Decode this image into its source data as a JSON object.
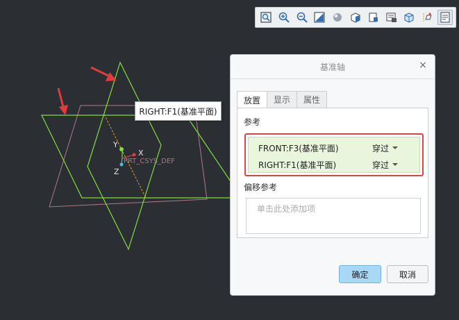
{
  "toolbar": {
    "buttons": [
      {
        "icon": "refit-icon"
      },
      {
        "icon": "zoom-in-icon"
      },
      {
        "icon": "zoom-out-icon"
      },
      {
        "icon": "repaint-icon"
      },
      {
        "icon": "shading-icon"
      },
      {
        "icon": "view-style-icon"
      },
      {
        "icon": "saved-orientations-icon"
      },
      {
        "icon": "view-manager-icon"
      },
      {
        "icon": "perspective-view-icon"
      },
      {
        "icon": "datum-display-icon"
      },
      {
        "icon": "annotation-display-icon"
      }
    ]
  },
  "viewport": {
    "csys_label": "PRT_CSYS_DEF",
    "axis_labels": {
      "x": "X",
      "y": "Y",
      "z": "Z"
    }
  },
  "tooltip": {
    "text": "RIGHT:F1(基准平面)"
  },
  "dialog": {
    "title": "基准轴",
    "close": "×",
    "tabs": [
      "放置",
      "显示",
      "属性"
    ],
    "references_label": "参考",
    "references": [
      {
        "name": "FRONT:F3(基准平面)",
        "type": "穿过"
      },
      {
        "name": "RIGHT:F1(基准平面)",
        "type": "穿过"
      }
    ],
    "offset_label": "偏移参考",
    "offset_placeholder": "单击此处添加项",
    "ok": "确定",
    "cancel": "取消"
  },
  "colors": {
    "background": "#2b2f33",
    "datum_plane_selected": "#7ee03a",
    "datum_plane": "#b07a86",
    "annotation_arrow": "#e33b3b",
    "highlight_border": "#e14141",
    "ok_button": "#a9d8f5"
  }
}
